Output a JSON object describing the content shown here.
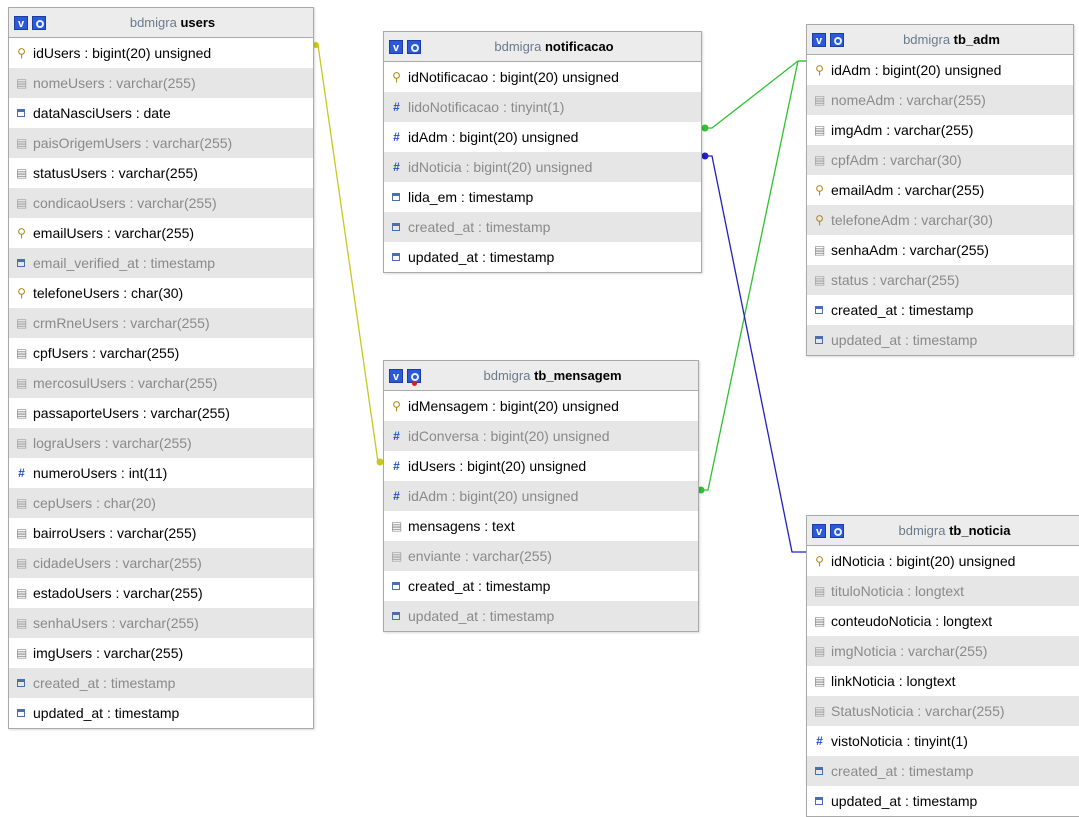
{
  "db_label": "bdmigra",
  "header_buttons": {
    "toggle": "v"
  },
  "tables": {
    "users": {
      "name": "users",
      "columns": [
        {
          "text": "idUsers : bigint(20) unsigned",
          "icon": "key-icon"
        },
        {
          "text": "nomeUsers : varchar(255)",
          "icon": "text-icon"
        },
        {
          "text": "dataNasciUsers : date",
          "icon": "date-icon"
        },
        {
          "text": "paisOrigemUsers : varchar(255)",
          "icon": "text-icon"
        },
        {
          "text": "statusUsers : varchar(255)",
          "icon": "text-icon"
        },
        {
          "text": "condicaoUsers : varchar(255)",
          "icon": "text-icon"
        },
        {
          "text": "emailUsers : varchar(255)",
          "icon": "key-icon"
        },
        {
          "text": "email_verified_at : timestamp",
          "icon": "date-icon"
        },
        {
          "text": "telefoneUsers : char(30)",
          "icon": "key-icon"
        },
        {
          "text": "crmRneUsers : varchar(255)",
          "icon": "text-icon"
        },
        {
          "text": "cpfUsers : varchar(255)",
          "icon": "text-icon"
        },
        {
          "text": "mercosulUsers : varchar(255)",
          "icon": "text-icon"
        },
        {
          "text": "passaporteUsers : varchar(255)",
          "icon": "text-icon"
        },
        {
          "text": "lograUsers : varchar(255)",
          "icon": "text-icon"
        },
        {
          "text": "numeroUsers : int(11)",
          "icon": "number-icon"
        },
        {
          "text": "cepUsers : char(20)",
          "icon": "text-icon"
        },
        {
          "text": "bairroUsers : varchar(255)",
          "icon": "text-icon"
        },
        {
          "text": "cidadeUsers : varchar(255)",
          "icon": "text-icon"
        },
        {
          "text": "estadoUsers : varchar(255)",
          "icon": "text-icon"
        },
        {
          "text": "senhaUsers : varchar(255)",
          "icon": "text-icon"
        },
        {
          "text": "imgUsers : varchar(255)",
          "icon": "text-icon"
        },
        {
          "text": "created_at : timestamp",
          "icon": "date-icon"
        },
        {
          "text": "updated_at : timestamp",
          "icon": "date-icon"
        }
      ]
    },
    "notificacao": {
      "name": "notificacao",
      "columns": [
        {
          "text": "idNotificacao : bigint(20) unsigned",
          "icon": "key-icon"
        },
        {
          "text": "lidoNotificacao : tinyint(1)",
          "icon": "number-icon"
        },
        {
          "text": "idAdm : bigint(20) unsigned",
          "icon": "number-icon"
        },
        {
          "text": "idNoticia : bigint(20) unsigned",
          "icon": "number-icon"
        },
        {
          "text": "lida_em : timestamp",
          "icon": "date-icon"
        },
        {
          "text": "created_at : timestamp",
          "icon": "date-icon"
        },
        {
          "text": "updated_at : timestamp",
          "icon": "date-icon"
        }
      ]
    },
    "tb_mensagem": {
      "name": "tb_mensagem",
      "columns": [
        {
          "text": "idMensagem : bigint(20) unsigned",
          "icon": "key-icon"
        },
        {
          "text": "idConversa : bigint(20) unsigned",
          "icon": "number-icon"
        },
        {
          "text": "idUsers : bigint(20) unsigned",
          "icon": "number-icon"
        },
        {
          "text": "idAdm : bigint(20) unsigned",
          "icon": "number-icon"
        },
        {
          "text": "mensagens : text",
          "icon": "text-icon"
        },
        {
          "text": "enviante : varchar(255)",
          "icon": "text-icon"
        },
        {
          "text": "created_at : timestamp",
          "icon": "date-icon"
        },
        {
          "text": "updated_at : timestamp",
          "icon": "date-icon"
        }
      ]
    },
    "tb_adm": {
      "name": "tb_adm",
      "columns": [
        {
          "text": "idAdm : bigint(20) unsigned",
          "icon": "key-icon"
        },
        {
          "text": "nomeAdm : varchar(255)",
          "icon": "text-icon"
        },
        {
          "text": "imgAdm : varchar(255)",
          "icon": "text-icon"
        },
        {
          "text": "cpfAdm : varchar(30)",
          "icon": "text-icon"
        },
        {
          "text": "emailAdm : varchar(255)",
          "icon": "key-icon"
        },
        {
          "text": "telefoneAdm : varchar(30)",
          "icon": "key-icon"
        },
        {
          "text": "senhaAdm : varchar(255)",
          "icon": "text-icon"
        },
        {
          "text": "status : varchar(255)",
          "icon": "text-icon"
        },
        {
          "text": "created_at : timestamp",
          "icon": "date-icon"
        },
        {
          "text": "updated_at : timestamp",
          "icon": "date-icon"
        }
      ]
    },
    "tb_noticia": {
      "name": "tb_noticia",
      "columns": [
        {
          "text": "idNoticia : bigint(20) unsigned",
          "icon": "key-icon"
        },
        {
          "text": "tituloNoticia : longtext",
          "icon": "text-icon"
        },
        {
          "text": "conteudoNoticia : longtext",
          "icon": "text-icon"
        },
        {
          "text": "imgNoticia : varchar(255)",
          "icon": "text-icon"
        },
        {
          "text": "linkNoticia : longtext",
          "icon": "text-icon"
        },
        {
          "text": "StatusNoticia : varchar(255)",
          "icon": "text-icon"
        },
        {
          "text": "vistoNoticia : tinyint(1)",
          "icon": "number-icon"
        },
        {
          "text": "created_at : timestamp",
          "icon": "date-icon"
        },
        {
          "text": "updated_at : timestamp",
          "icon": "date-icon"
        }
      ]
    }
  },
  "relation_colors": {
    "users_to_mensagem": "#c8c820",
    "adm_links": "#2fc22f",
    "noticia_link": "#2020c0"
  }
}
